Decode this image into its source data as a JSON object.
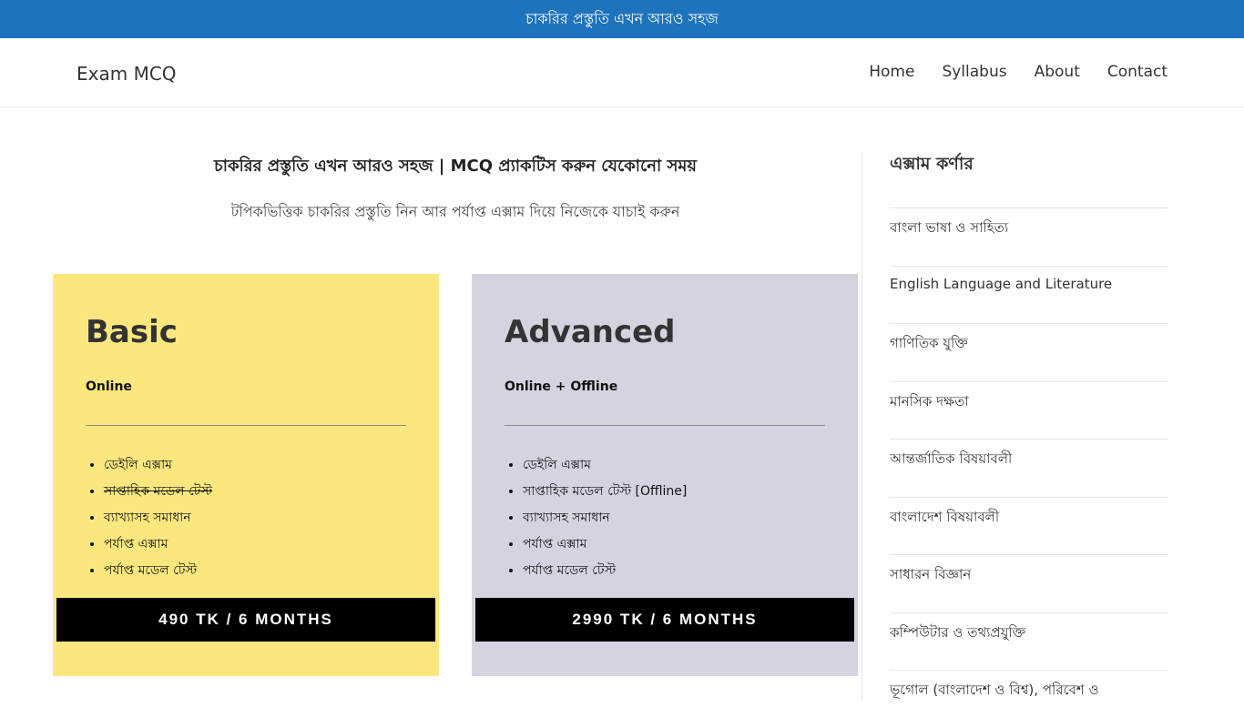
{
  "topbar": {
    "text": "চাকরির প্রস্তুতি এখন আরও সহজ"
  },
  "header": {
    "logo": "Exam MCQ",
    "nav": [
      {
        "label": "Home"
      },
      {
        "label": "Syllabus"
      },
      {
        "label": "About"
      },
      {
        "label": "Contact"
      }
    ]
  },
  "main": {
    "headline": "চাকরির প্রস্তুতি এখন আরও সহজ | MCQ প্র্যাকটিস করুন যেকোনো সময়",
    "subline": "টপিকভিত্তিক চাকরির প্রস্তুতি নিন আর পর্যাপ্ত এক্সাম দিয়ে নিজেকে যাচাই করুন"
  },
  "plans": {
    "basic": {
      "title": "Basic",
      "mode": "Online",
      "features": [
        "ডেইলি এক্সাম",
        "সাপ্তাহিক মডেল টেস্ট",
        "ব্যাখ্যাসহ সমাধান",
        "পর্যাপ্ত এক্সাম",
        "পর্যাপ্ত মডেল টেস্ট"
      ],
      "price": "490 TK / 6 MONTHS",
      "color": "#fce77e"
    },
    "advanced": {
      "title": "Advanced",
      "mode": "Online + Offline",
      "features": [
        "ডেইলি এক্সাম",
        "সাপ্তাহিক মডেল টেস্ট [Offline]",
        "ব্যাখ্যাসহ সমাধান",
        "পর্যাপ্ত এক্সাম",
        "পর্যাপ্ত মডেল টেস্ট"
      ],
      "price": "2990 TK / 6 MONTHS",
      "color": "#d4d4e1"
    }
  },
  "sidebar": {
    "title": "এক্সাম কর্ণার",
    "items": [
      "বাংলা ভাষা ও সাহিত্য",
      "English Language and Literature",
      "গাণিতিক যুক্তি",
      "মানসিক দক্ষতা",
      "আন্তর্জাতিক বিষয়াবলী",
      "বাংলাদেশ বিষয়াবলী",
      "সাধারন বিজ্ঞান",
      "কম্পিউটার ও তথ্যপ্রযুক্তি",
      "ভূগোল (বাংলাদেশ ও বিশ্ব), পরিবেশ ও"
    ]
  },
  "colors": {
    "topbar": "#1e73be",
    "price_button": "#000000"
  }
}
